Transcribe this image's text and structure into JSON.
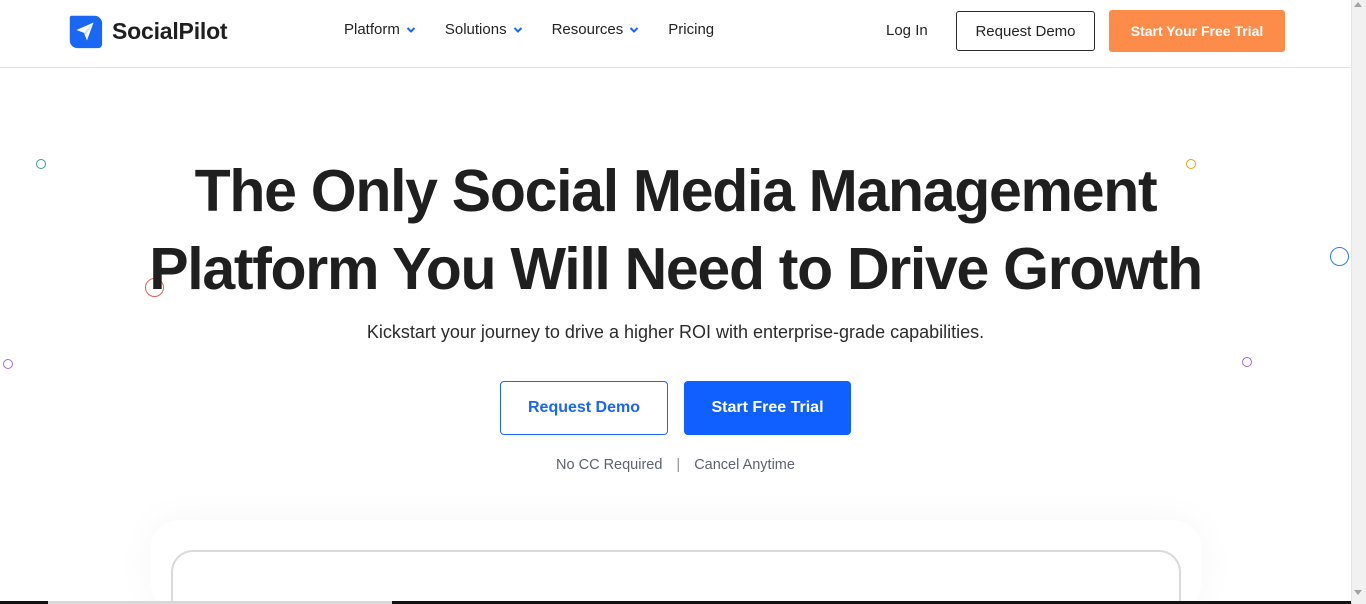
{
  "brand": {
    "name": "SocialPilot"
  },
  "nav": {
    "items": [
      {
        "label": "Platform",
        "has_dropdown": true
      },
      {
        "label": "Solutions",
        "has_dropdown": true
      },
      {
        "label": "Resources",
        "has_dropdown": true
      },
      {
        "label": "Pricing",
        "has_dropdown": false
      }
    ],
    "login": "Log In",
    "request_demo": "Request Demo",
    "free_trial": "Start Your Free Trial"
  },
  "hero": {
    "title_line1": "The Only Social Media Management",
    "title_line2": "Platform You Will Need to Drive Growth",
    "subtitle": "Kickstart your journey to drive a higher ROI with enterprise-grade capabilities.",
    "cta_demo": "Request Demo",
    "cta_trial": "Start Free Trial",
    "note_left": "No CC Required",
    "note_sep": "|",
    "note_right": "Cancel Anytime"
  },
  "colors": {
    "primary_blue": "#1060ff",
    "accent_orange": "#fd8b49",
    "text_dark": "#1f1f1f"
  },
  "icons": [
    "paper-plane-logo-icon",
    "chevron-down-icon"
  ]
}
